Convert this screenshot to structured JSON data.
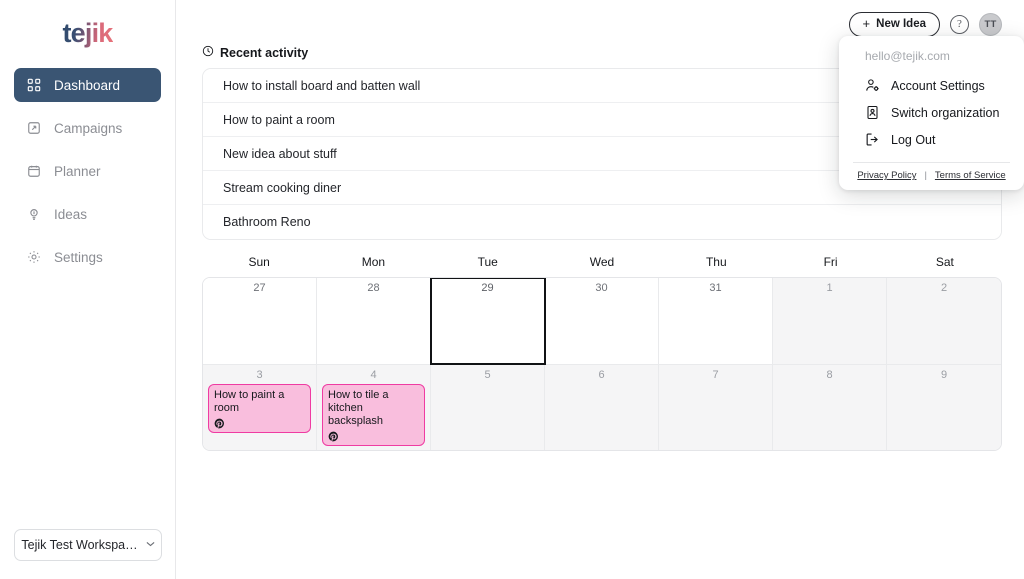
{
  "brand": {
    "logo_text": "tejik",
    "logo_gradient_start": "#2e4a6b",
    "logo_gradient_end": "#e8737a"
  },
  "sidebar": {
    "items": [
      {
        "label": "Dashboard",
        "icon": "grid-icon",
        "active": true
      },
      {
        "label": "Campaigns",
        "icon": "campaign-icon",
        "active": false
      },
      {
        "label": "Planner",
        "icon": "calendar-icon",
        "active": false
      },
      {
        "label": "Ideas",
        "icon": "lightbulb-icon",
        "active": false
      },
      {
        "label": "Settings",
        "icon": "gear-icon",
        "active": false
      }
    ],
    "workspace": {
      "label": "Tejik Test Workspa…",
      "chevron": "⌄"
    }
  },
  "topbar": {
    "new_idea_label": "New Idea",
    "new_idea_plus": "+",
    "help_label": "?",
    "avatar_initials": "TT"
  },
  "account_menu": {
    "email": "hello@tejik.com",
    "items": [
      {
        "label": "Account Settings",
        "icon": "user-gear-icon"
      },
      {
        "label": "Switch organization",
        "icon": "organization-icon"
      },
      {
        "label": "Log Out",
        "icon": "logout-icon"
      }
    ],
    "footer": {
      "privacy_label": "Privacy Policy",
      "separator": "|",
      "terms_label": "Terms of Service"
    }
  },
  "recent_activity": {
    "title": "Recent activity",
    "icon": "clock-icon",
    "rows": [
      "How to install board and batten wall",
      "How to paint a room",
      "New idea about stuff",
      "Stream cooking diner",
      "Bathroom Reno"
    ]
  },
  "calendar": {
    "day_headers": [
      "Sun",
      "Mon",
      "Tue",
      "Wed",
      "Thu",
      "Fri",
      "Sat"
    ],
    "accent_event_bg": "#f9bedd",
    "accent_event_border": "#ef3ba2",
    "weeks": [
      [
        {
          "day": "27",
          "out": false,
          "today": false,
          "events": []
        },
        {
          "day": "28",
          "out": false,
          "today": false,
          "events": []
        },
        {
          "day": "29",
          "out": false,
          "today": true,
          "events": []
        },
        {
          "day": "30",
          "out": false,
          "today": false,
          "events": []
        },
        {
          "day": "31",
          "out": false,
          "today": false,
          "events": []
        },
        {
          "day": "1",
          "out": true,
          "today": false,
          "events": []
        },
        {
          "day": "2",
          "out": true,
          "today": false,
          "events": []
        }
      ],
      [
        {
          "day": "3",
          "out": true,
          "today": false,
          "events": [
            {
              "title": "How to paint a room",
              "platform": "pinterest-icon"
            }
          ]
        },
        {
          "day": "4",
          "out": true,
          "today": false,
          "events": [
            {
              "title": "How to tile a kitchen backsplash",
              "platform": "pinterest-icon"
            }
          ]
        },
        {
          "day": "5",
          "out": true,
          "today": false,
          "events": []
        },
        {
          "day": "6",
          "out": true,
          "today": false,
          "events": []
        },
        {
          "day": "7",
          "out": true,
          "today": false,
          "events": []
        },
        {
          "day": "8",
          "out": true,
          "today": false,
          "events": []
        },
        {
          "day": "9",
          "out": true,
          "today": false,
          "events": []
        }
      ]
    ]
  }
}
